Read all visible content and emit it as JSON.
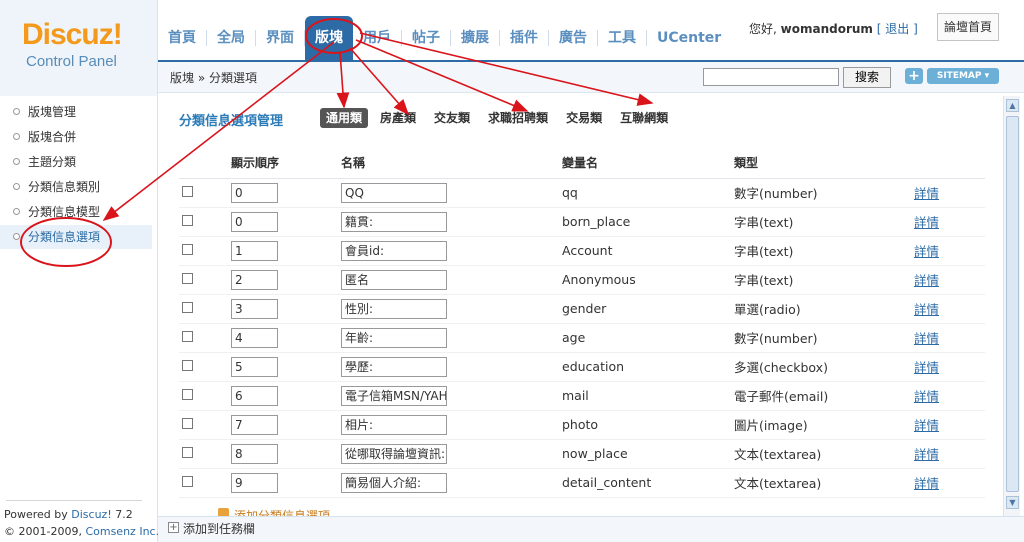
{
  "brand": {
    "logo": "Discuz!",
    "subtitle": "Control Panel"
  },
  "topnav": [
    {
      "label": "首頁",
      "active": false
    },
    {
      "label": "全局",
      "active": false
    },
    {
      "label": "界面",
      "active": false
    },
    {
      "label": "版塊",
      "active": true
    },
    {
      "label": "用戶",
      "active": false
    },
    {
      "label": "帖子",
      "active": false
    },
    {
      "label": "擴展",
      "active": false
    },
    {
      "label": "插件",
      "active": false
    },
    {
      "label": "廣告",
      "active": false
    },
    {
      "label": "工具",
      "active": false
    },
    {
      "label": "UCenter",
      "active": false
    }
  ],
  "user": {
    "greeting": "您好,",
    "username": "womandorum",
    "logout": "[ 退出 ]",
    "home_button": "論壇首頁"
  },
  "breadcrumb": "版塊 » 分類選項",
  "search": {
    "value": "",
    "button": "搜索"
  },
  "toolbar": {
    "plus": "+",
    "sitemap": "SITEMAP ▾"
  },
  "sidebar": {
    "items": [
      {
        "label": "版塊管理",
        "active": false
      },
      {
        "label": "版塊合併",
        "active": false
      },
      {
        "label": "主題分類",
        "active": false
      },
      {
        "label": "分類信息類別",
        "active": false
      },
      {
        "label": "分類信息模型",
        "active": false
      },
      {
        "label": "分類信息選項",
        "active": true
      }
    ],
    "powered_prefix": "Powered by",
    "powered_brand": "Discuz!",
    "powered_version": "7.2",
    "copyright_prefix": "© 2001-2009,",
    "copyright_brand": "Comsenz Inc."
  },
  "panel": {
    "title": "分類信息選項管理",
    "tabs": [
      {
        "label": "通用類",
        "active": true
      },
      {
        "label": "房產類",
        "active": false
      },
      {
        "label": "交友類",
        "active": false
      },
      {
        "label": "求職招聘類",
        "active": false
      },
      {
        "label": "交易類",
        "active": false
      },
      {
        "label": "互聯網類",
        "active": false
      }
    ],
    "columns": {
      "checkbox": "",
      "order": "顯示順序",
      "name": "名稱",
      "variable": "變量名",
      "type": "類型",
      "action": ""
    },
    "rows": [
      {
        "order": "0",
        "name": "QQ",
        "variable": "qq",
        "type": "數字(number)",
        "action": "詳情"
      },
      {
        "order": "0",
        "name": "籍貫:",
        "variable": "born_place",
        "type": "字串(text)",
        "action": "詳情"
      },
      {
        "order": "1",
        "name": "會員id:",
        "variable": "Account",
        "type": "字串(text)",
        "action": "詳情"
      },
      {
        "order": "2",
        "name": "匿名",
        "variable": "Anonymous",
        "type": "字串(text)",
        "action": "詳情"
      },
      {
        "order": "3",
        "name": "性別:",
        "variable": "gender",
        "type": "單選(radio)",
        "action": "詳情"
      },
      {
        "order": "4",
        "name": "年齡:",
        "variable": "age",
        "type": "數字(number)",
        "action": "詳情"
      },
      {
        "order": "5",
        "name": "學歷:",
        "variable": "education",
        "type": "多選(checkbox)",
        "action": "詳情"
      },
      {
        "order": "6",
        "name": "電子信箱MSN/YAH",
        "variable": "mail",
        "type": "電子郵件(email)",
        "action": "詳情"
      },
      {
        "order": "7",
        "name": "相片:",
        "variable": "photo",
        "type": "圖片(image)",
        "action": "詳情"
      },
      {
        "order": "8",
        "name": "從哪取得論壇資訊:",
        "variable": "now_place",
        "type": "文本(textarea)",
        "action": "詳情"
      },
      {
        "order": "9",
        "name": "簡易個人介紹:",
        "variable": "detail_content",
        "type": "文本(textarea)",
        "action": "詳情"
      }
    ],
    "add_option": "添加分類信息選項"
  },
  "taskbar": {
    "label": "添加到任務欄"
  },
  "colors": {
    "accent": "#2c6ba5",
    "annotation": "#d9141b",
    "logo": "#f39a1c"
  }
}
